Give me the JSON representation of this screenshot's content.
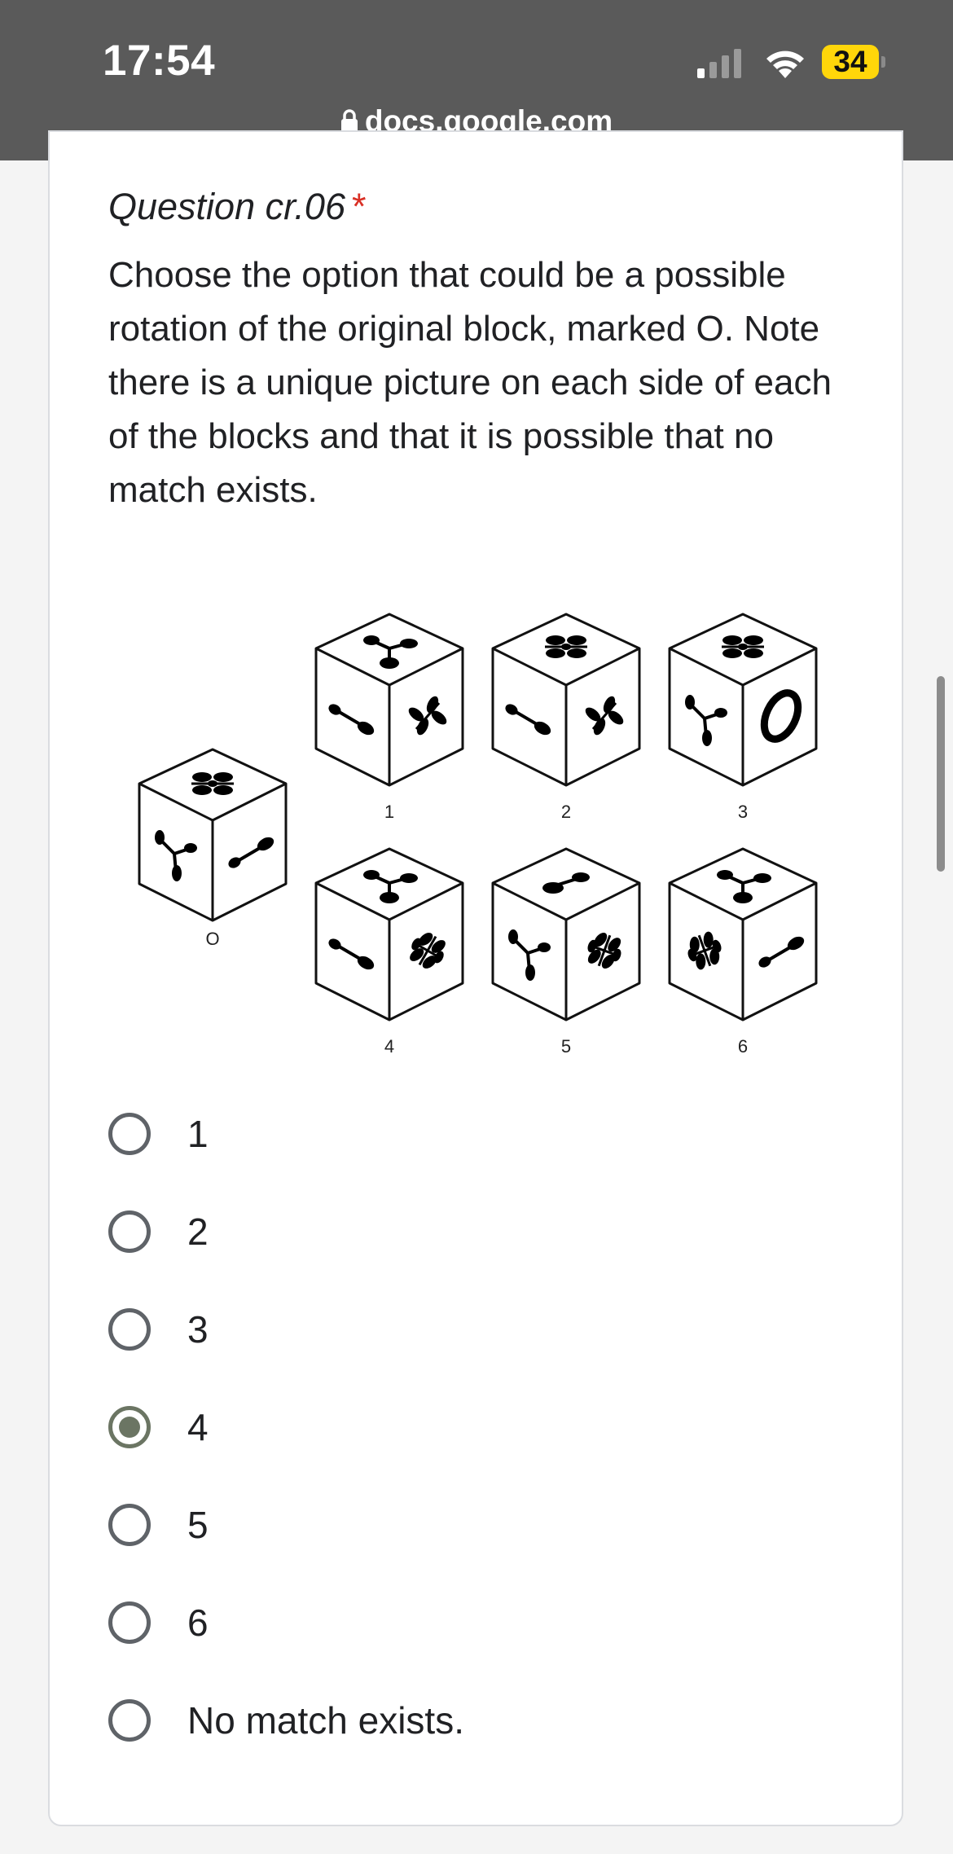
{
  "status_bar": {
    "time": "17:54",
    "battery": "34"
  },
  "browser": {
    "url": "docs.google.com"
  },
  "question": {
    "title": "Question cr.06",
    "required_marker": "*",
    "description": "Choose the option that could be a possible rotation of the original block, marked O. Note there is a unique picture on each side of each of the blocks and that it is possible that no match exists."
  },
  "figure": {
    "original_label": "O",
    "cube_labels": [
      "1",
      "2",
      "3",
      "4",
      "5",
      "6"
    ]
  },
  "options": [
    {
      "label": "1",
      "selected": false
    },
    {
      "label": "2",
      "selected": false
    },
    {
      "label": "3",
      "selected": false
    },
    {
      "label": "4",
      "selected": true
    },
    {
      "label": "5",
      "selected": false
    },
    {
      "label": "6",
      "selected": false
    },
    {
      "label": "No match exists.",
      "selected": false
    }
  ],
  "colors": {
    "topbar": "#5a5a5a",
    "required": "#d93025",
    "selected_radio": "#6b7563",
    "battery": "#ffd60a"
  }
}
